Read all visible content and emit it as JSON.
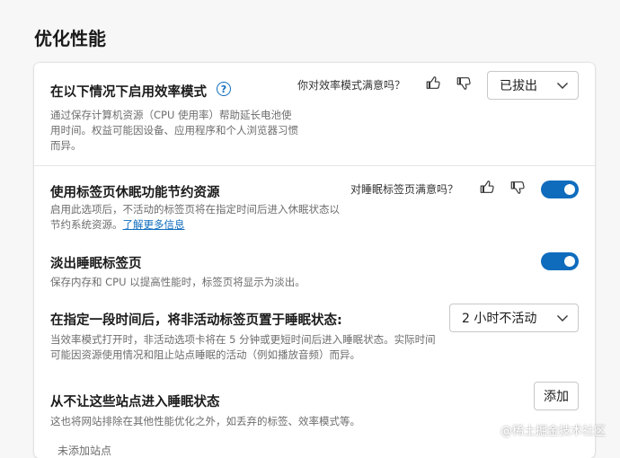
{
  "page": {
    "title": "优化性能"
  },
  "efficiency": {
    "title": "在以下情况下启用效率模式",
    "help_icon": "?",
    "description": "通过保存计算机资源（CPU 使用率）帮助延长电池使用时间。权益可能因设备、应用程序和个人浏览器习惯而异。",
    "feedback_question": "你对效率模式满意吗？",
    "dropdown_value": "已拔出"
  },
  "sleeping_tabs": {
    "title": "使用标签页休眠功能节约资源",
    "description": "启用此选项后，不活动的标签页将在指定时间后进入休眠状态以节约系统资源。",
    "learn_more": "了解更多信息",
    "feedback_question": "对睡眠标签页满意吗？",
    "enabled": true
  },
  "fade_tabs": {
    "title": "淡出睡眠标签页",
    "description": "保存内存和 CPU 以提高性能时，标签页将显示为淡出。",
    "enabled": true
  },
  "sleep_timeout": {
    "title": "在指定一段时间后，将非活动标签页置于睡眠状态:",
    "description": "当效率模式打开时，非活动选项卡将在 5 分钟或更短时间后进入睡眠状态。实际时间可能因资源使用情况和阻止站点睡眠的活动（例如播放音频）而异。",
    "dropdown_value": "2 小时不活动"
  },
  "never_sleep": {
    "title": "从不让这些站点进入睡眠状态",
    "description": "这也将网站排除在其他性能优化之外，如丢弃的标签、效率模式等。",
    "add_button": "添加",
    "empty_text": "未添加站点"
  },
  "watermark": "@稀土掘金技术社区",
  "colors": {
    "accent": "#0f6cbd",
    "background": "#f7f7f7",
    "card": "#ffffff"
  }
}
